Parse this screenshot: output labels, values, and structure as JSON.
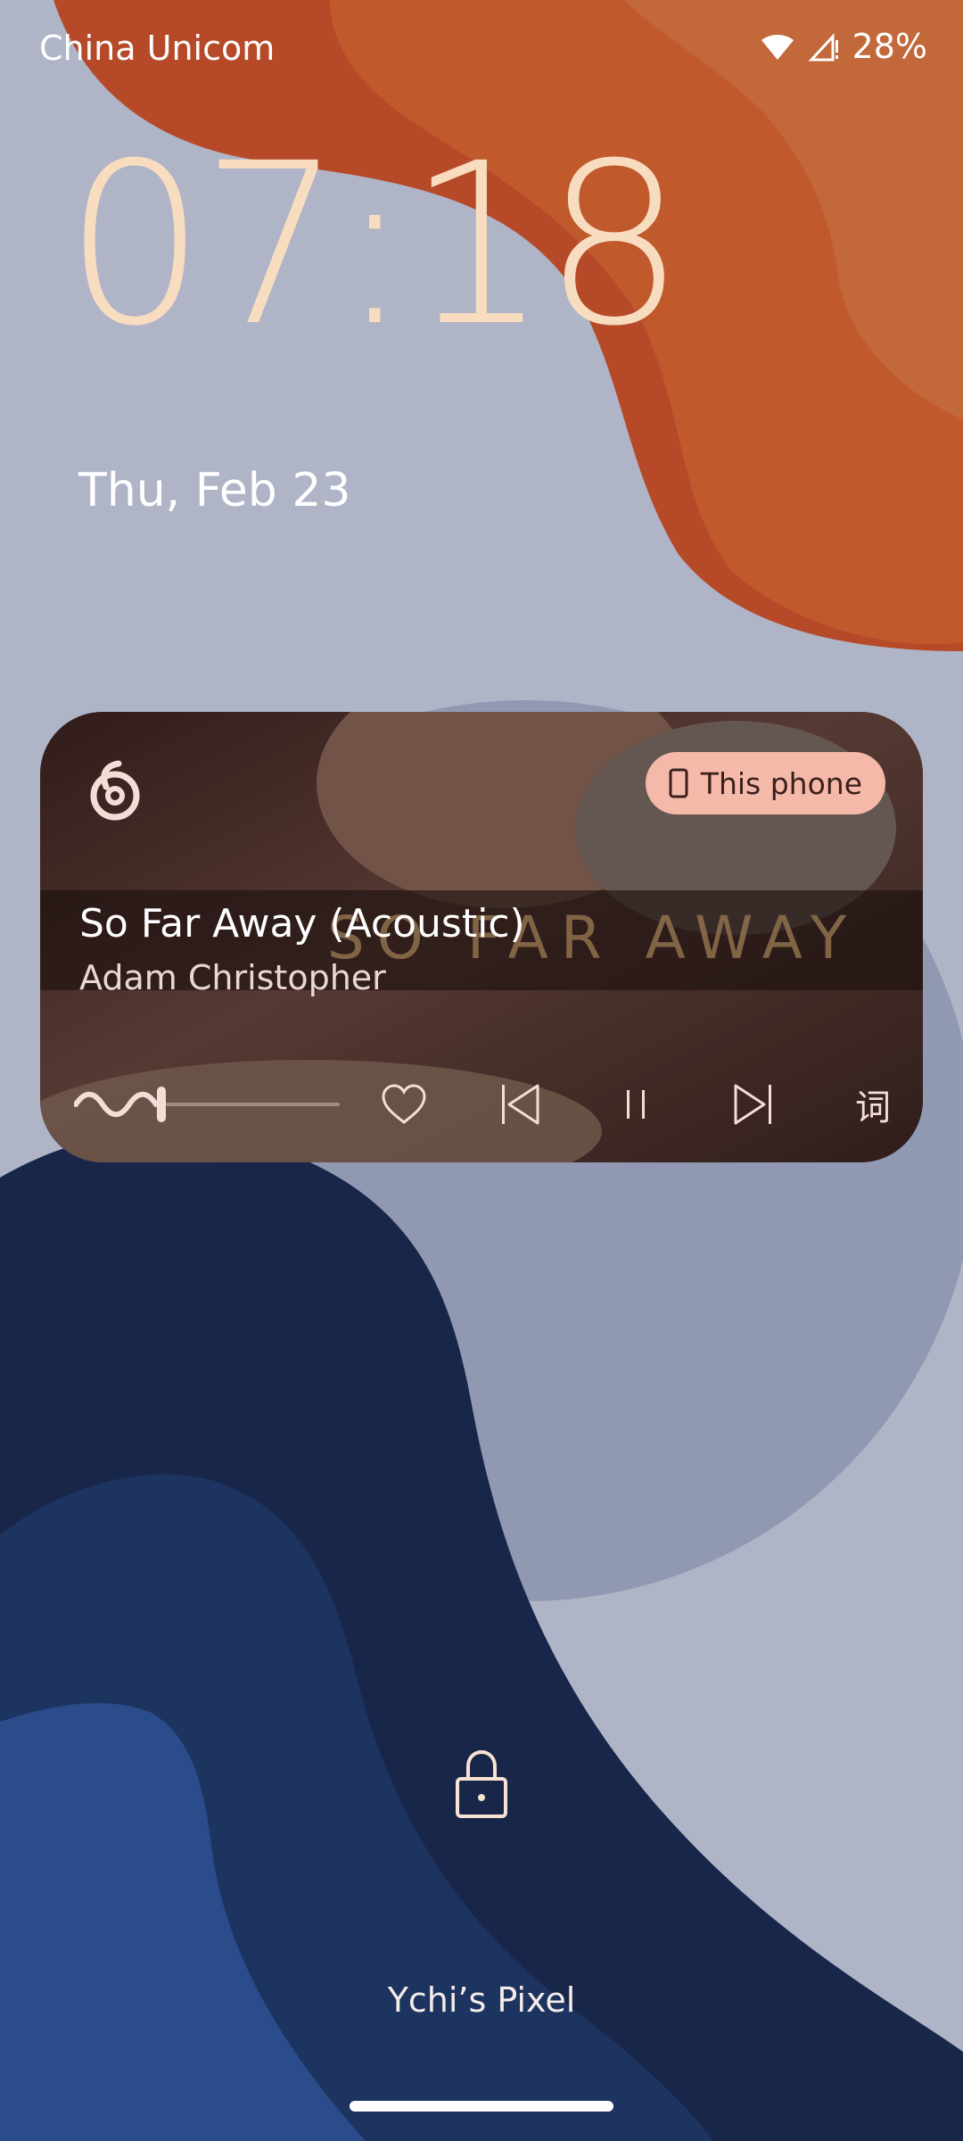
{
  "status_bar": {
    "carrier": "China Unicom",
    "battery": "28%",
    "icons": [
      "wifi-icon",
      "cell-signal-icon"
    ]
  },
  "lockscreen": {
    "time": "07:18",
    "date": "Thu, Feb 23",
    "owner_label": "Ychi’s Pixel"
  },
  "media": {
    "app_icon": "netease-music-icon",
    "output_device": "This phone",
    "title": "So Far Away (Acoustic)",
    "artist": "Adam Christopher",
    "album_art_text": "SO FAR AWAY",
    "progress": 0.35,
    "controls": {
      "like": "heart-icon",
      "previous": "skip-previous-icon",
      "pause": "pause-icon",
      "next": "skip-next-icon",
      "lyrics": "词"
    }
  },
  "colors": {
    "clock": "#f8dcc0",
    "chip_bg": "#f5b9aa",
    "wallpaper_orange": "#b94f2b",
    "wallpaper_navy": "#182645"
  }
}
